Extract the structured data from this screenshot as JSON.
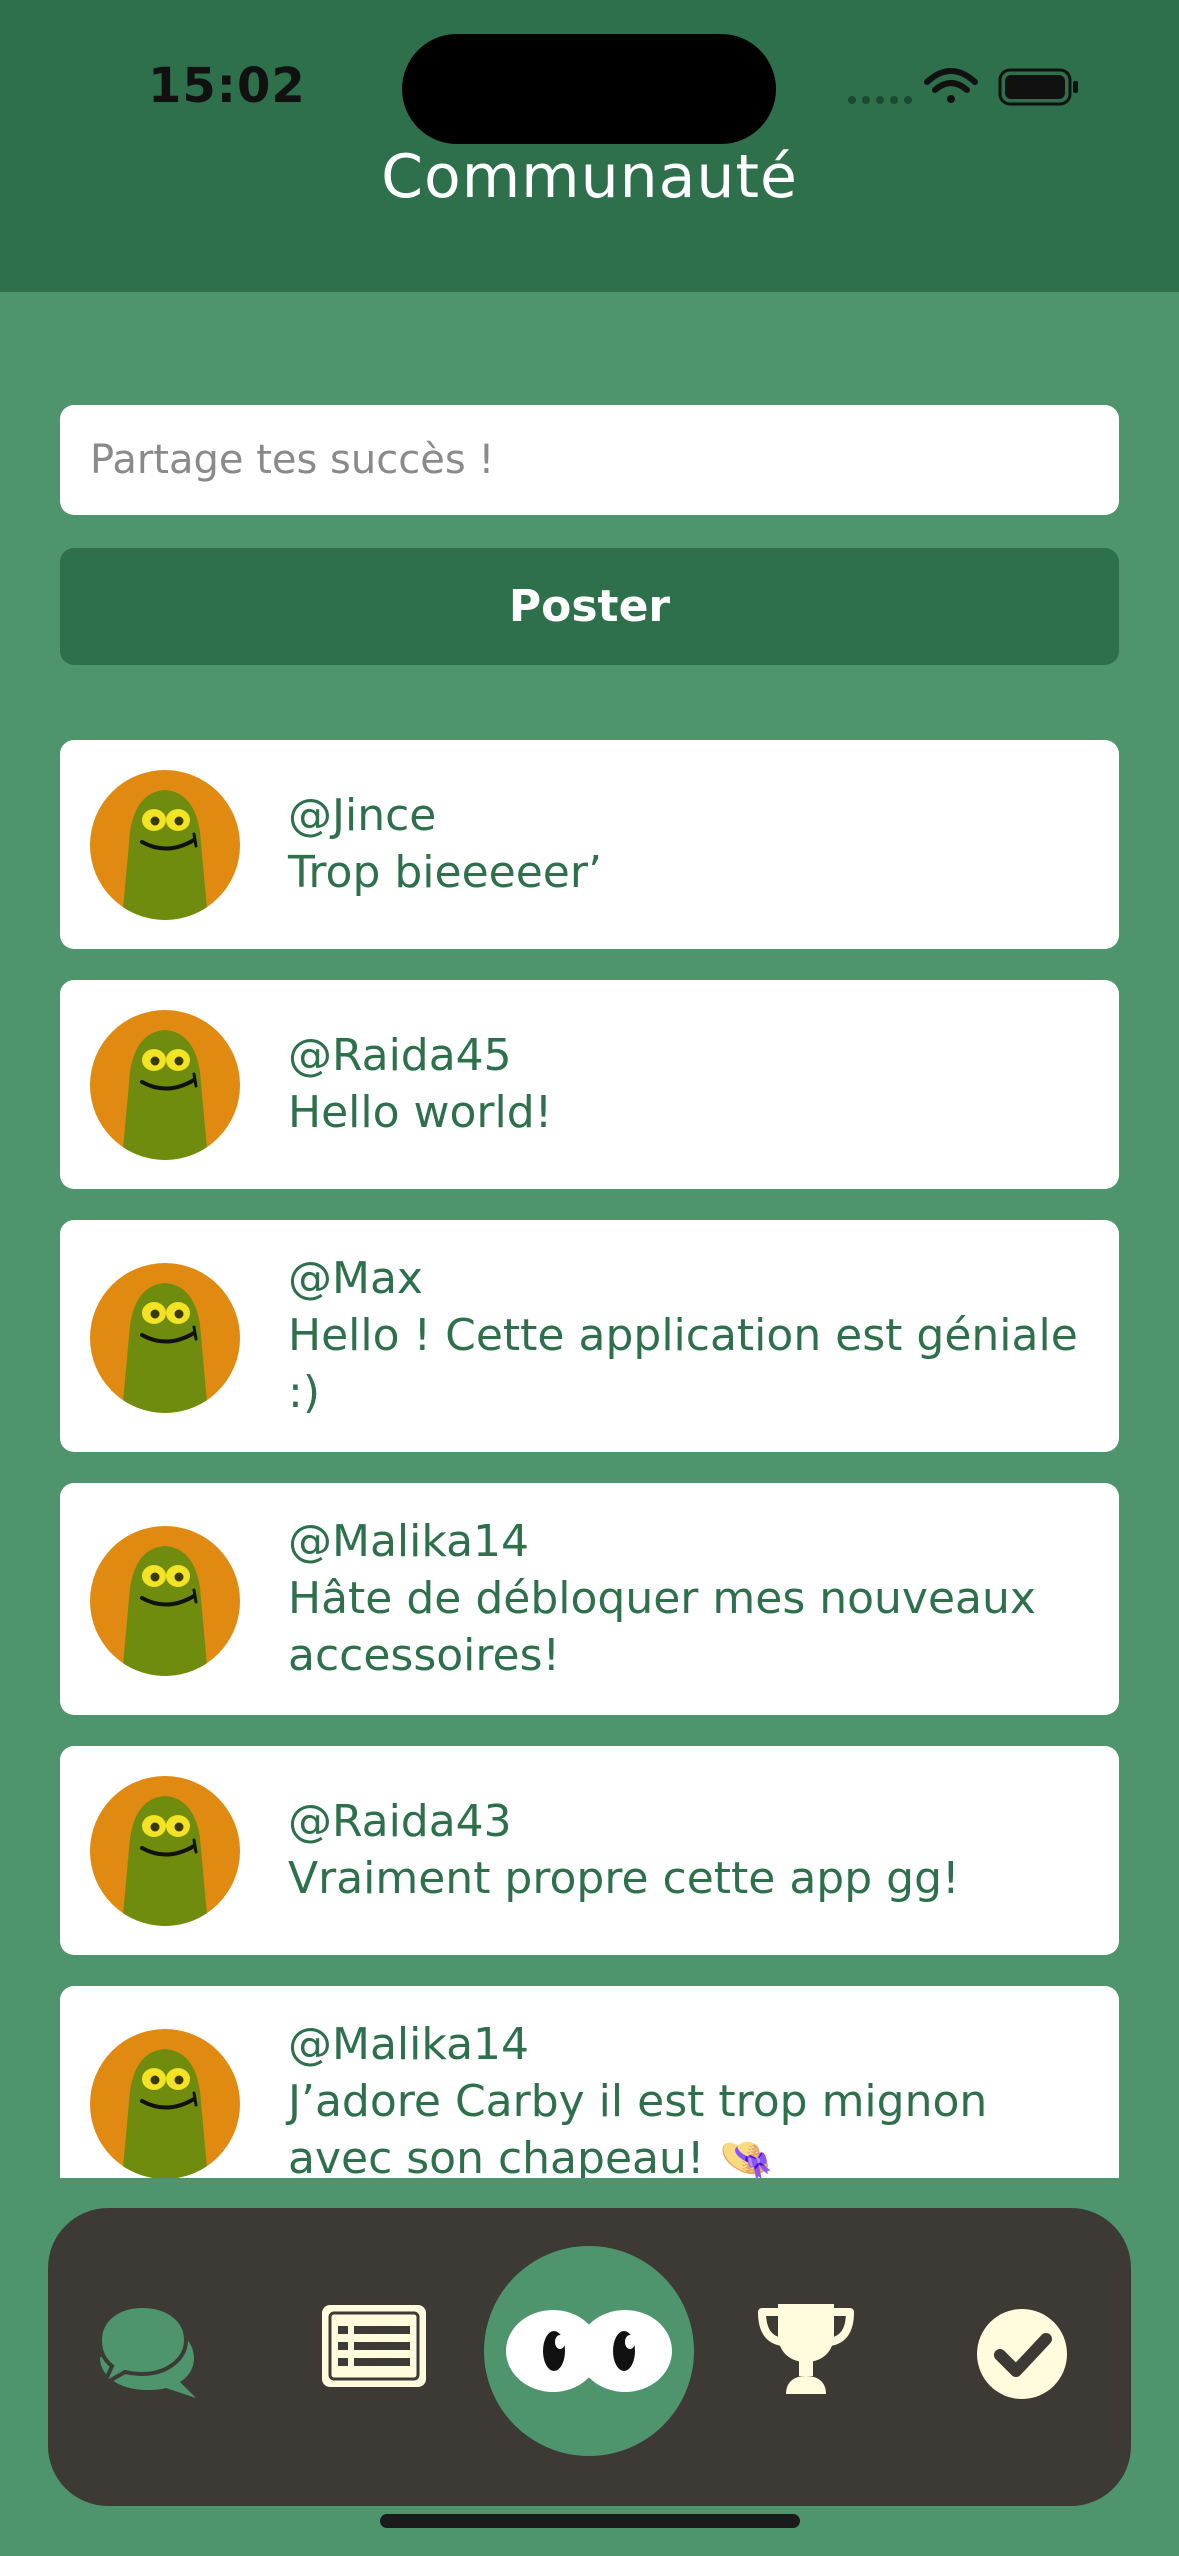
{
  "status_bar": {
    "time": "15:02"
  },
  "header": {
    "title": "Communauté"
  },
  "composer": {
    "input_value": "",
    "input_placeholder": "Partage tes succès !",
    "post_button_label": "Poster"
  },
  "feed": {
    "posts": [
      {
        "user": "@Jince",
        "message": "Trop bieeeeer’"
      },
      {
        "user": "@Raida45",
        "message": "Hello world!"
      },
      {
        "user": "@Max",
        "message": "Hello ! Cette application est géniale :)"
      },
      {
        "user": "@Malika14",
        "message": "Hâte de débloquer mes nouveaux accessoires!"
      },
      {
        "user": "@Raida43",
        "message": "Vraiment propre cette app gg!"
      },
      {
        "user": "@Malika14",
        "message": "J’adore Carby il est trop mignon avec son chapeau! 👒"
      }
    ]
  },
  "tab_bar": {
    "tabs": [
      {
        "icon": "chat-bubbles-icon",
        "active": true
      },
      {
        "icon": "list-icon",
        "active": false
      },
      {
        "icon": "mascot-eyes-icon",
        "active": false
      },
      {
        "icon": "trophy-icon",
        "active": false
      },
      {
        "icon": "check-circle-icon",
        "active": false
      }
    ]
  },
  "colors": {
    "background": "#4e956d",
    "header": "#2d704b",
    "card_text": "#2d704b",
    "tab_bar": "#3d3a36",
    "tab_icon": "#fffbdc",
    "avatar_orange": "#e08a12",
    "avatar_green": "#6f8c0f"
  }
}
